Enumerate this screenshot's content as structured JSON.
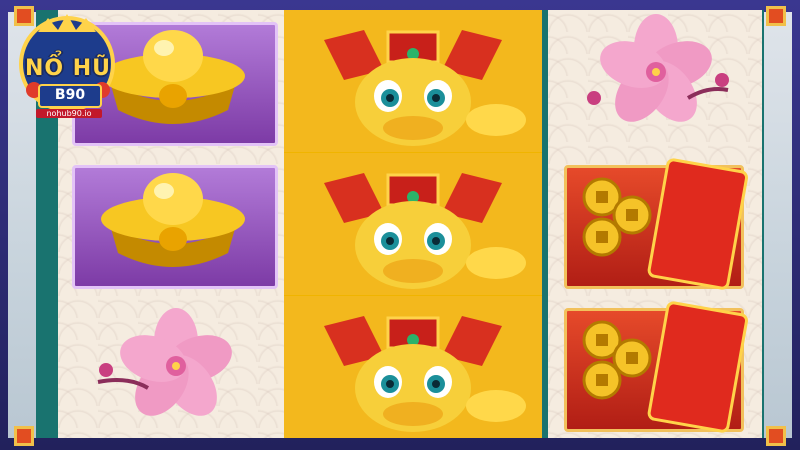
{
  "logo": {
    "title": "NỔ HŨ",
    "badge": "B90",
    "site": "nohub90.io"
  },
  "colors": {
    "frame": "#2a2766",
    "reel_border": "#19736f",
    "reel_bg": "#f5ece0",
    "gold": "#f0b400",
    "purple_tile": "#8f4bb8",
    "red_envelope": "#d8231a"
  },
  "reels": [
    {
      "index": 1,
      "symbols": [
        "gold-ingot",
        "gold-ingot",
        "plum-blossom"
      ]
    },
    {
      "index": 2,
      "symbols": [
        "golden-dragon",
        "golden-dragon",
        "golden-dragon"
      ]
    },
    {
      "index": 3,
      "symbols": [
        "plum-blossom",
        "red-envelope-coins",
        "red-envelope-coins"
      ]
    }
  ]
}
